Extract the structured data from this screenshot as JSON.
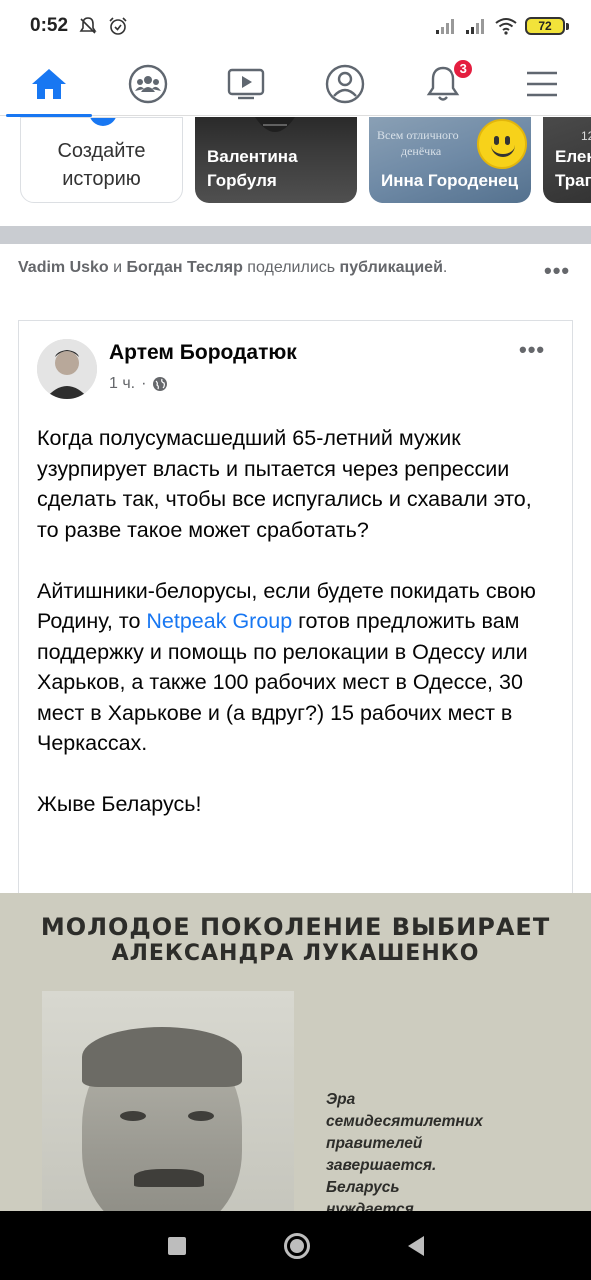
{
  "status_bar": {
    "time": "0:52",
    "battery": "72"
  },
  "nav": {
    "items": [
      {
        "name": "home",
        "active": true
      },
      {
        "name": "groups",
        "active": false
      },
      {
        "name": "watch",
        "active": false
      },
      {
        "name": "profile",
        "active": false
      },
      {
        "name": "notifications",
        "badge": "3",
        "active": false
      },
      {
        "name": "menu",
        "active": false
      }
    ],
    "notifications_badge": "3"
  },
  "stories": {
    "create_line1": "Создайте",
    "create_line2": "историю",
    "items": [
      {
        "name_line1": "Валентина",
        "name_line2": "Горбуля"
      },
      {
        "overlay_line1": "Всем отличного",
        "overlay_line2": "денёчка",
        "name_line1": "Инна Городенец",
        "name_line2": ""
      },
      {
        "overlay_num": "12",
        "name_line1": "Елен",
        "name_line2": "Трап"
      }
    ]
  },
  "feed": {
    "shared_by_1": "Vadim Usko",
    "shared_and": " и ",
    "shared_by_2": "Богдан Тесляр",
    "shared_action": " поделились ",
    "shared_object": "публикацией",
    "shared_dot": "."
  },
  "post": {
    "author": "Артем Бородатюк",
    "time": "1 ч.",
    "separator": "·",
    "paragraph1": "Когда полусумасшедший 65-летний мужик узурпирует власть и пытается через репрессии сделать так, чтобы все испугались и схавали это, то разве такое может сработать?",
    "paragraph2_before": "Айтишники-белорусы, если будете покидать свою Родину, то ",
    "paragraph2_link": "Netpeak Group",
    "paragraph2_after": " готов предложить вам поддержку и помощь по релокации в Одессу или Харьков, а также 100 рабочих мест в Одессе, 30 мест в Харькове и (а вдруг?) 15 рабочих мест в Черкассах.",
    "paragraph3": "Жыве Беларусь!"
  },
  "image": {
    "headline1": "МОЛОДОЕ ПОКОЛЕНИЕ ВЫБИРАЕТ",
    "headline2": "АЛЕКСАНДРА ЛУКАШЕНКО",
    "caption_line1": "Эра",
    "caption_line2": "семидесятилетних",
    "caption_line3": "правителей",
    "caption_line4": "завершается.",
    "caption_line5": "Беларусь",
    "caption_line6": "нуждается"
  },
  "colors": {
    "accent": "#1877f2",
    "badge": "#e41e3f",
    "separator": "#c9ccd1",
    "secondary_text": "#65676b"
  }
}
